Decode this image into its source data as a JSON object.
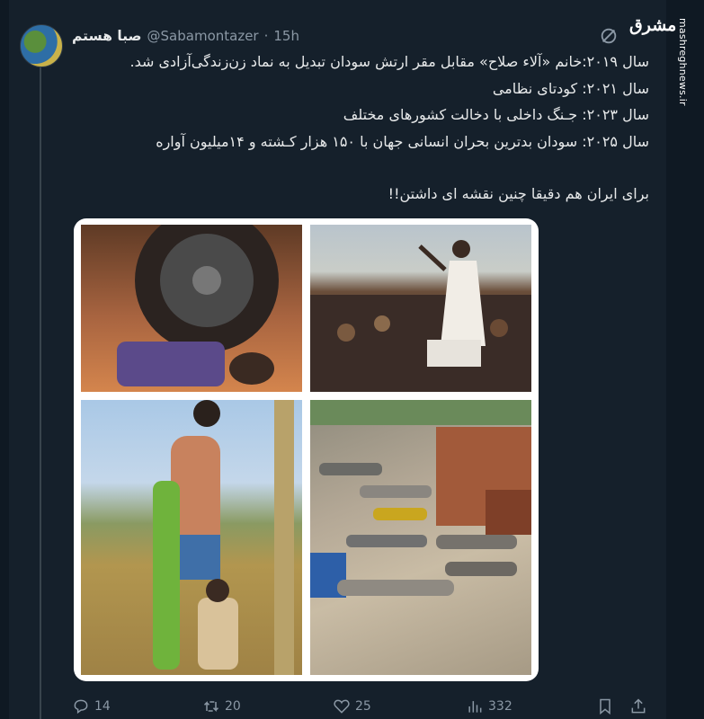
{
  "tweet": {
    "display_name": "صبا هستم",
    "handle": "@Sabamontazer",
    "separator": "·",
    "time": "15h",
    "lines": [
      "سال ۲۰۱۹:خانم «آلاء صلاح» مقابل مقر ارتش سودان تبدیل به نماد زن‌زندگی‌آزادی شد.",
      "سال ۲۰۲۱: کودتای نظامی",
      "سال ۲۰۲۳: جـنگ داخلی با دخالت کشورهای مختلف",
      "سال ۲۰۲۵: سودان بدترین بحران انسانی جهان با ۱۵۰ هزار کـشته و ۱۴میلیون آواره",
      "برای ایران هم دقیقا چنین نقشه ای داشتن!!"
    ]
  },
  "watermark": {
    "logo_text": "مشرق",
    "site_text": "mashreghnews.ir"
  },
  "actions": {
    "replies": "14",
    "reposts": "20",
    "likes": "25",
    "views": "332"
  },
  "icons": {
    "reply": "reply-icon",
    "repost": "repost-icon",
    "like": "heart-icon",
    "views": "views-icon",
    "bookmark": "bookmark-icon",
    "share": "share-icon",
    "grok": "grok-icon"
  },
  "colors": {
    "background": "#15202b",
    "text": "#e7e9ea",
    "muted": "#8b98a5"
  }
}
